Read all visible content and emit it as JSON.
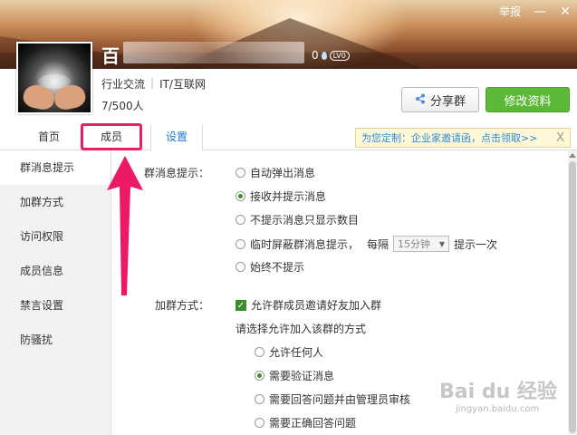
{
  "window": {
    "report_label": "举报",
    "minimize": "—",
    "close": "✕"
  },
  "group": {
    "name_initial": "百",
    "level_count": "0",
    "level_badge": "LV0",
    "category": "行业交流",
    "industry": "IT/互联网",
    "member_count": "7/500人"
  },
  "actions": {
    "share_label": "分享群",
    "edit_label": "修改资料"
  },
  "tabs": [
    {
      "label": "首页"
    },
    {
      "label": "成员"
    },
    {
      "label": "设置"
    }
  ],
  "promo": {
    "text": "为您定制：企业家邀请函，点击领取>>",
    "close": "X"
  },
  "sidebar": {
    "items": [
      {
        "label": "群消息提示"
      },
      {
        "label": "加群方式"
      },
      {
        "label": "访问权限"
      },
      {
        "label": "成员信息"
      },
      {
        "label": "禁言设置"
      },
      {
        "label": "防骚扰"
      }
    ]
  },
  "message_settings": {
    "label": "群消息提示：",
    "options": [
      {
        "label": "自动弹出消息",
        "selected": false
      },
      {
        "label": "接收并提示消息",
        "selected": true
      },
      {
        "label": "不提示消息只显示数目",
        "selected": false
      },
      {
        "label": "临时屏蔽群消息提示，",
        "selected": false
      },
      {
        "label": "始终不提示",
        "selected": false
      }
    ],
    "interval_prefix": "每隔",
    "interval_value": "15分钟",
    "interval_suffix": "提示一次"
  },
  "join_settings": {
    "label": "加群方式：",
    "allow_invite": "允许群成员邀请好友加入群",
    "allow_invite_checked": true,
    "method_prompt": "请选择允许加入该群的方式",
    "options": [
      {
        "label": "允许任何人",
        "selected": false
      },
      {
        "label": "需要验证消息",
        "selected": true
      },
      {
        "label": "需要回答问题并由管理员审核",
        "selected": false
      },
      {
        "label": "需要正确回答问题",
        "selected": false
      }
    ]
  },
  "watermark": {
    "brand": "Bai du 经验",
    "url": "jingyan.baidu.com"
  },
  "colors": {
    "accent_green": "#5cb837",
    "link_blue": "#1a7ccf",
    "highlight_pink": "#e91e63"
  }
}
